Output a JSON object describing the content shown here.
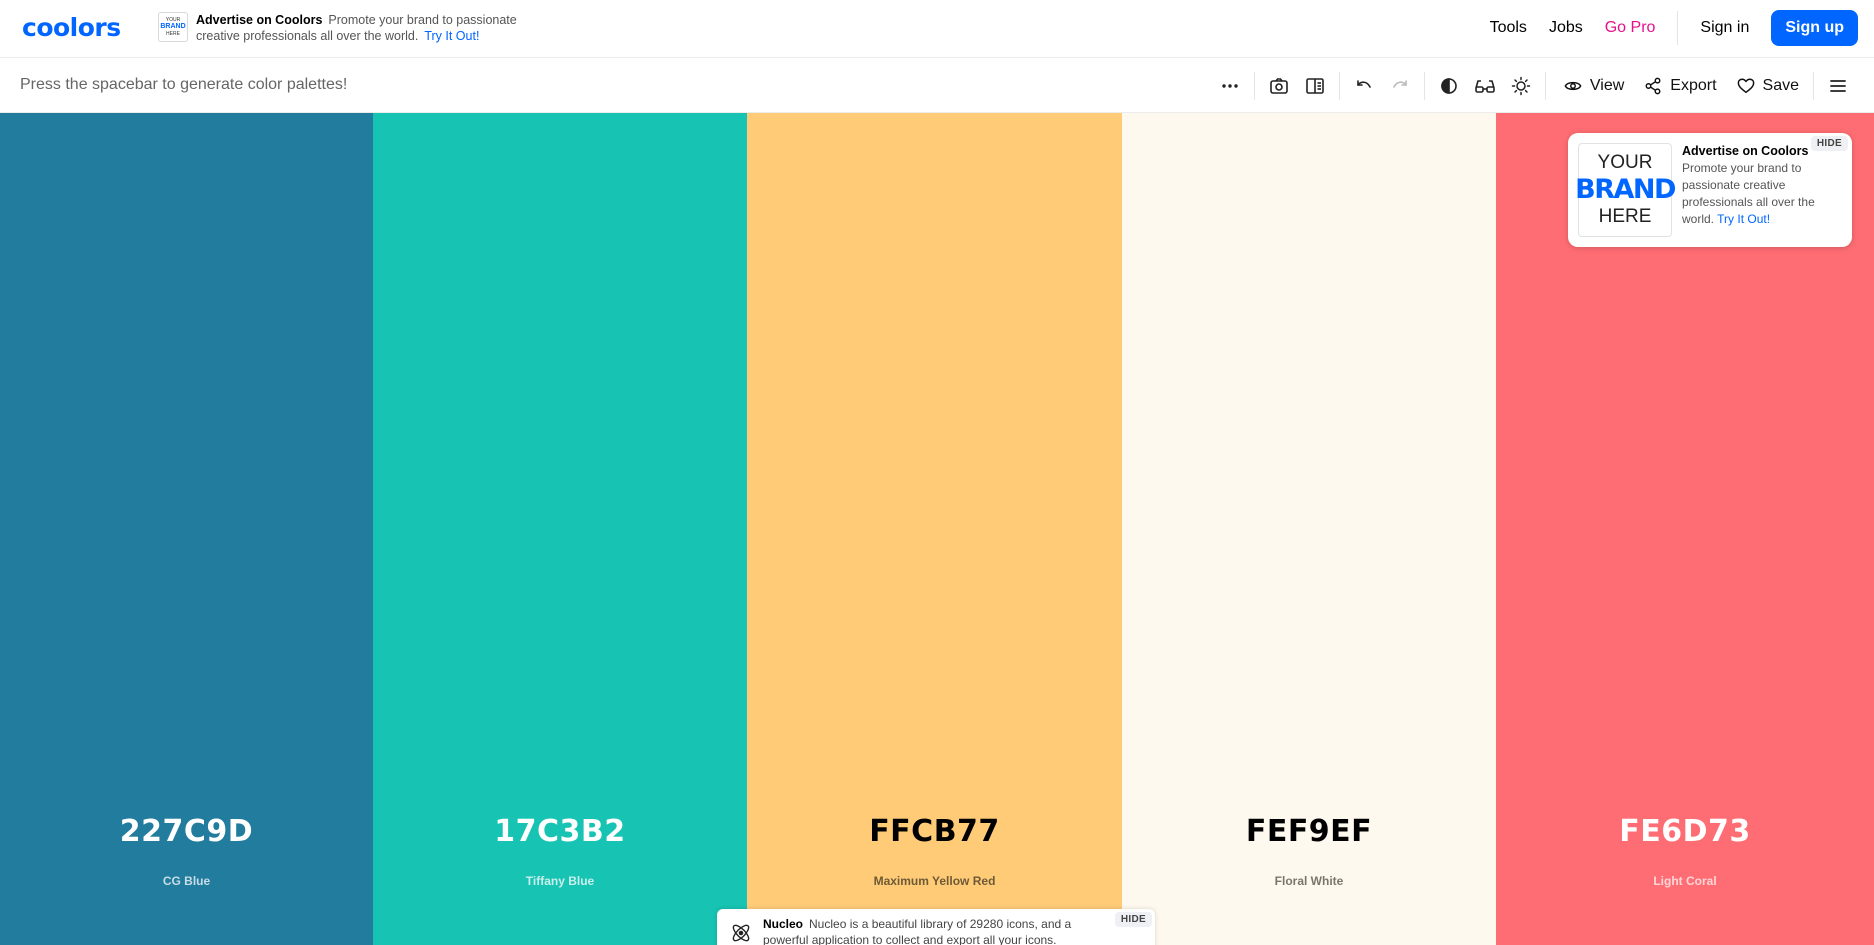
{
  "header": {
    "logo": "coolors",
    "ad": {
      "thumb_lines": [
        "YOUR",
        "BRAND",
        "HERE"
      ],
      "title": "Advertise on Coolors",
      "text": "Promote your brand to passionate creative professionals all over the world.",
      "link": "Try It Out!"
    },
    "nav": {
      "tools": "Tools",
      "jobs": "Jobs",
      "go_pro": "Go Pro",
      "sign_in": "Sign in",
      "sign_up": "Sign up"
    }
  },
  "toolbar": {
    "hint": "Press the spacebar to generate color palettes!",
    "icons": {
      "more": "more-horizontal-icon",
      "camera": "camera-icon",
      "layout": "layout-icon",
      "undo": "undo-icon",
      "redo": "redo-icon",
      "contrast": "contrast-icon",
      "glasses": "glasses-icon",
      "sun": "sun-icon",
      "menu": "hamburger-menu-icon"
    },
    "view_label": "View",
    "export_label": "Export",
    "save_label": "Save"
  },
  "palette": [
    {
      "hex": "227C9D",
      "name": "CG Blue",
      "color": "#227C9D",
      "text_color": "#ffffff",
      "name_color": "#c6dde6"
    },
    {
      "hex": "17C3B2",
      "name": "Tiffany Blue",
      "color": "#17C3B2",
      "text_color": "#ffffff",
      "name_color": "#c8efeb"
    },
    {
      "hex": "FFCB77",
      "name": "Maximum Yellow Red",
      "color": "#FFCB77",
      "text_color": "#000000",
      "name_color": "#6e5a36"
    },
    {
      "hex": "FEF9EF",
      "name": "Floral White",
      "color": "#FEF9EF",
      "text_color": "#000000",
      "name_color": "#7a766e"
    },
    {
      "hex": "FE6D73",
      "name": "Light Coral",
      "color": "#FE6D73",
      "text_color": "#ffffff",
      "name_color": "#ffd6d8"
    }
  ],
  "ad_card": {
    "brand_lines": [
      "YOUR",
      "BRAND",
      "HERE"
    ],
    "title": "Advertise on Coolors",
    "text": "Promote your brand to passionate creative professionals all over the world.",
    "link": "Try It Out!",
    "hide": "HIDE"
  },
  "ad_bottom": {
    "title": "Nucleo",
    "text": "Nucleo is a beautiful library of 29280 icons, and a powerful application to collect and export all your icons.",
    "hide": "HIDE",
    "icon": "atom-icon"
  },
  "colors": {
    "accent": "#0066ff",
    "pro": "#e6118a"
  }
}
